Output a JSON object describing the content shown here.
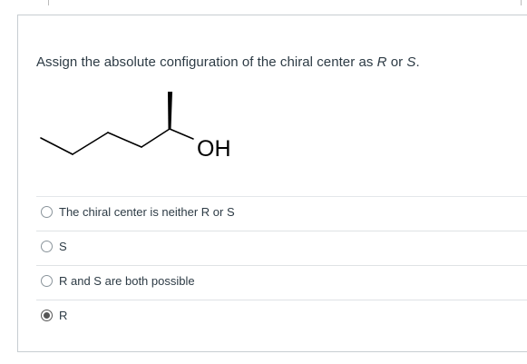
{
  "question": {
    "prompt_prefix": "Assign the absolute configuration of the chiral center as ",
    "prompt_r": "R",
    "prompt_or": " or ",
    "prompt_s": "S",
    "prompt_suffix": "."
  },
  "molecule": {
    "substituent_label": "OH"
  },
  "answers": [
    {
      "label": "The chiral center is neither R or S",
      "selected": false
    },
    {
      "label": "S",
      "selected": false
    },
    {
      "label": "R and S are both possible",
      "selected": false
    },
    {
      "label": "R",
      "selected": true
    }
  ]
}
